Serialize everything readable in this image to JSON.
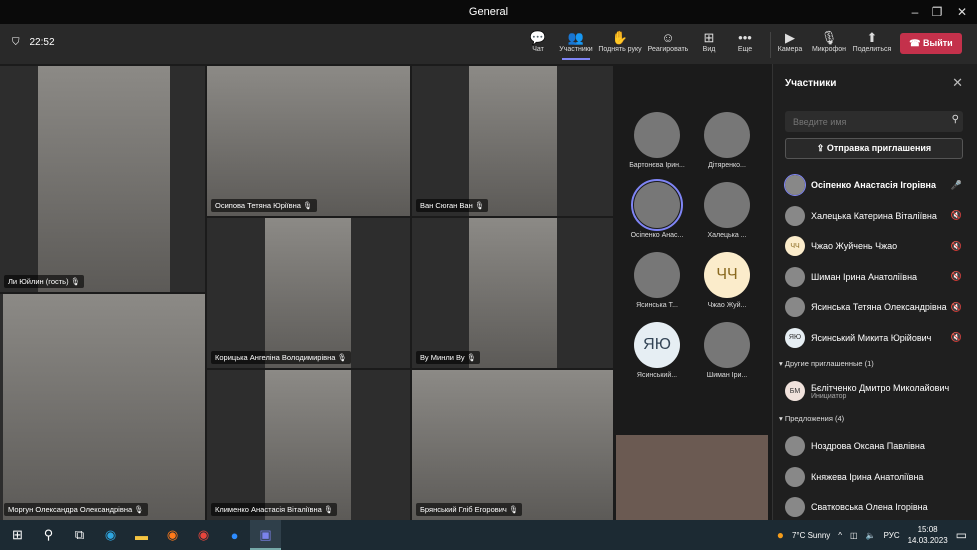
{
  "window": {
    "title": "General",
    "minimize": "–",
    "restore": "❐",
    "close": "✕"
  },
  "toolbar": {
    "timer": "22:52",
    "buttons": [
      {
        "label": "Чат",
        "icon": "chat-icon",
        "glyph": "💬"
      },
      {
        "label": "Участники",
        "icon": "people-icon",
        "glyph": "👥"
      },
      {
        "label": "Поднять руку",
        "icon": "hand-icon",
        "glyph": "✋"
      },
      {
        "label": "Реагировать",
        "icon": "smiley-icon",
        "glyph": "☺"
      },
      {
        "label": "Вид",
        "icon": "grid-icon",
        "glyph": "⊞"
      },
      {
        "label": "Еще",
        "icon": "more-icon",
        "glyph": "•••"
      },
      {
        "label": "Камера",
        "icon": "camera-icon",
        "glyph": "▶"
      },
      {
        "label": "Микрофон",
        "icon": "mic-icon",
        "glyph": "🎙"
      },
      {
        "label": "Поделиться",
        "icon": "share-icon",
        "glyph": "⬆"
      }
    ],
    "leave": "Выйти"
  },
  "videos": [
    "Ли Юйлин (гость)",
    "Осипова Тетяна Юріївна",
    "Ван Сюган Ван",
    "Моргун Олександра Олександрівна",
    "Корицька Ангеліна Володимирівна",
    "Ву Минли Ву",
    "Клименко Анастасія Віталіївна",
    "Брянський Гліб Егорович"
  ],
  "gallery": [
    {
      "name": "Бартонєва Ірин...",
      "initials": ""
    },
    {
      "name": "Дітяренко...",
      "initials": ""
    },
    {
      "name": "Осіпенко Анас...",
      "initials": ""
    },
    {
      "name": "Халецька ...",
      "initials": ""
    },
    {
      "name": "Ясинська Т...",
      "initials": ""
    },
    {
      "name": "Чжао Жуй...",
      "initials": "ЧЧ"
    },
    {
      "name": "Ясинський...",
      "initials": "ЯЮ"
    },
    {
      "name": "Шиман Іри...",
      "initials": ""
    }
  ],
  "panel": {
    "title": "Участники",
    "search_placeholder": "Введите имя",
    "invite": "Отправка приглашения",
    "participants": [
      {
        "name": "Осіпенко Анастасія Ігорівна",
        "initials": "",
        "mic": "on"
      },
      {
        "name": "Халецька Катерина Віталіївна",
        "initials": "",
        "mic": "muted"
      },
      {
        "name": "Чжао Жуйчень Чжао",
        "initials": "ЧЧ",
        "mic": "muted"
      },
      {
        "name": "Шиман Ірина Анатоліївна",
        "initials": "",
        "mic": "muted"
      },
      {
        "name": "Ясинська Тетяна Олександрівна",
        "initials": "",
        "mic": "muted"
      },
      {
        "name": "Ясинський Микита Юрійович",
        "initials": "ЯЮ",
        "mic": "muted"
      }
    ],
    "others_header": "Другие приглашенные (1)",
    "others": [
      {
        "name": "Бєлітченко Дмитро Миколайович",
        "initials": "БМ",
        "role": "Инициатор"
      }
    ],
    "suggest_header": "Предложения (4)",
    "suggestions": [
      {
        "name": "Ноздрова Оксана Павлівна"
      },
      {
        "name": "Княжева Ірина Анатоліївна"
      },
      {
        "name": "Сватковська Олена Ігорівна"
      }
    ]
  },
  "taskbar": {
    "weather": "7°C Sunny",
    "lang": "РУС",
    "time": "15:08",
    "date": "14.03.2023"
  },
  "colors": {
    "accent": "#7f85f5",
    "leave": "#c4314b"
  }
}
